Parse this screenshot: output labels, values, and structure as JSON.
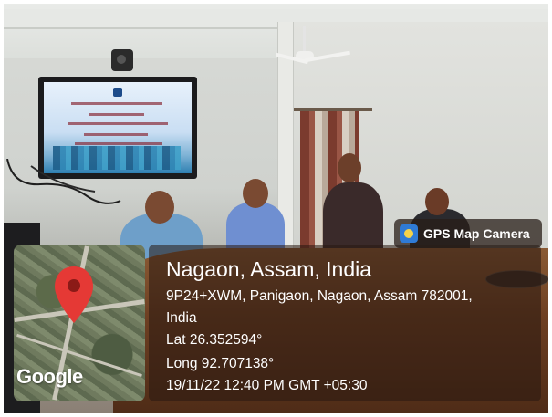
{
  "gps_badge": {
    "icon": "gps-map-camera-icon",
    "label": "GPS Map Camera"
  },
  "location": {
    "title": "Nagaon, Assam, India",
    "address_line1": "9P24+XWM, Panigaon, Nagaon, Assam 782001,",
    "address_line2": "India",
    "lat": "Lat 26.352594°",
    "long": "Long 92.707138°",
    "timestamp": "19/11/22 12:40 PM GMT +05:30"
  },
  "map": {
    "provider": "Google",
    "pin_color": "#e53935"
  }
}
